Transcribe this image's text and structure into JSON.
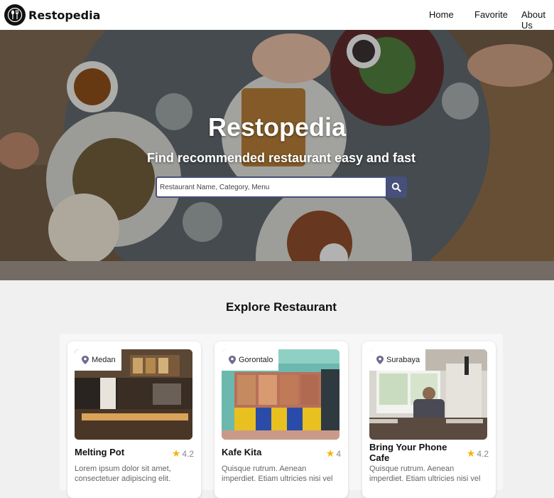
{
  "navbar": {
    "brand": "Restopedia",
    "links": [
      "Home",
      "Favorite",
      "About Us"
    ]
  },
  "hero": {
    "title": "Restopedia",
    "subtitle": "Find recommended restaurant easy and fast",
    "search": {
      "placeholder": "Restaurant Name, Category, Menu",
      "value": ""
    }
  },
  "explore": {
    "title": "Explore Restaurant",
    "restaurants": [
      {
        "city": "Medan",
        "name": "Melting Pot",
        "rating": "4.2",
        "description": "Lorem ipsum dolor sit amet, consectetuer adipiscing elit."
      },
      {
        "city": "Gorontalo",
        "name": "Kafe Kita",
        "rating": "4",
        "description": "Quisque rutrum. Aenean imperdiet. Etiam ultricies nisi vel"
      },
      {
        "city": "Surabaya",
        "name": "Bring Your Phone Cafe",
        "rating": "4.2",
        "description": "Quisque rutrum. Aenean imperdiet. Etiam ultricies nisi vel"
      }
    ]
  },
  "colors": {
    "accent": "#46507a",
    "star": "#f2b807"
  },
  "icons": {
    "logo": "fork-spoon-icon",
    "search": "search-icon",
    "pin": "map-pin-icon",
    "star": "star-icon"
  }
}
